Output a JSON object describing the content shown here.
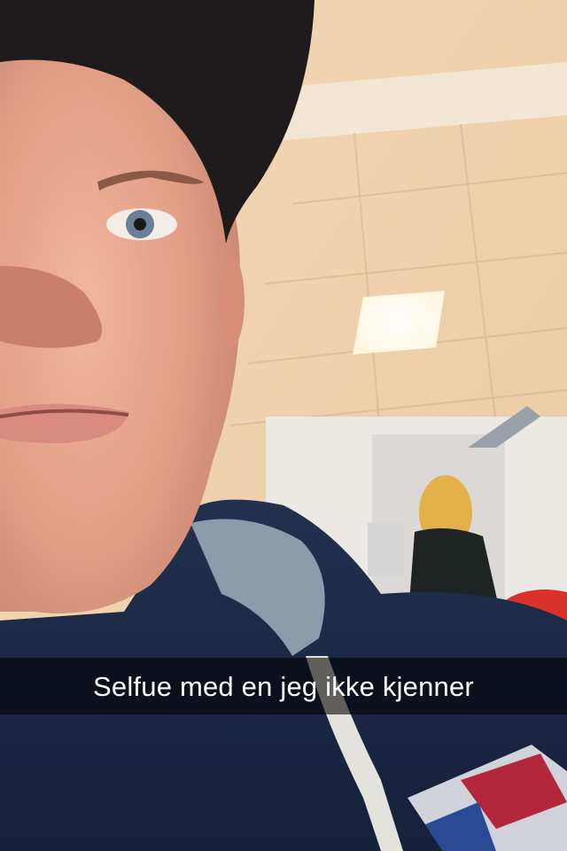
{
  "snap": {
    "caption": "Selfue med en jeg ikke kjenner"
  },
  "scene": {
    "description_colors": {
      "ceiling": "#efd2ad",
      "skin": "#e8a88f",
      "cap": "#1f1a1c",
      "hoodie": "#1c2a44",
      "hood_lining": "#8a9aa8",
      "red_chair": "#d9322a"
    }
  }
}
